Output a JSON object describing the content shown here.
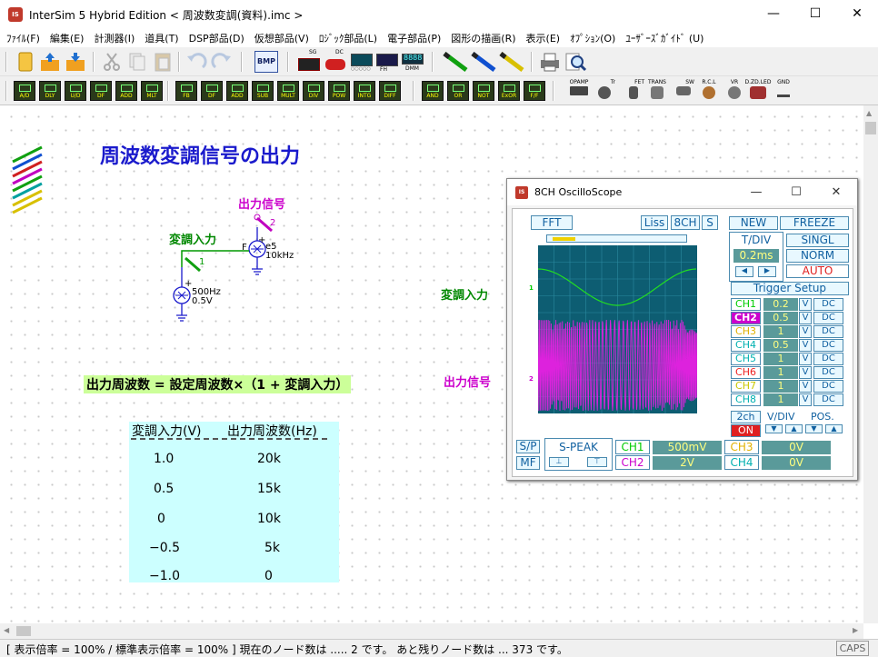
{
  "window": {
    "app_icon_text": "IS",
    "title": "InterSim 5  Hybrid Edition  < 周波数変調(資料).imc >",
    "minimize": "—",
    "maximize": "☐",
    "close": "✕"
  },
  "menu": [
    "ﾌｧｲﾙ(F)",
    "編集(E)",
    "計測器(I)",
    "道具(T)",
    "DSP部品(D)",
    "仮想部品(V)",
    "ﾛｼﾞｯｸ部品(L)",
    "電子部品(P)",
    "図形の描画(R)",
    "表示(E)",
    "ｵﾌﾟｼｮﾝ(O)",
    "ﾕｰｻﾞｰｽﾞｶﾞｲﾄﾞ (U)"
  ],
  "toolbar1": {
    "icons": [
      "new-file-icon",
      "open-file-icon",
      "save-file-icon",
      "cut-icon",
      "copy-icon",
      "paste-icon",
      "undo-icon",
      "redo-icon",
      "bmp-export-icon",
      "signal-generator-icon",
      "dc-source-icon",
      "oscilloscope-icon",
      "spectrum-icon",
      "digital-meter-icon",
      "probe-green-icon",
      "probe-blue-icon",
      "probe-yellow-icon",
      "print-icon",
      "print-preview-icon"
    ],
    "labels": {
      "bmp": "BMP",
      "sg": "SG",
      "dc": "DC",
      "fh": "FH",
      "dmm": "DMM",
      "digits": "8888"
    }
  },
  "toolbar2": {
    "dsp_buttons": [
      "A/D",
      "DLY",
      "U/D",
      "DF",
      "ADD",
      "MLT",
      "FB",
      "DF",
      "ADD",
      "SUB",
      "MULT",
      "DIV",
      "POW",
      "INTG",
      "DIFF"
    ],
    "logic_buttons": [
      "AND",
      "OR",
      "NOT",
      "ExOR",
      "F/F"
    ],
    "components": [
      "OPAMP",
      "Tr",
      "FET",
      "TRANS",
      "SW",
      "R.C.L",
      "VR",
      "D.ZD.LED",
      "GND"
    ]
  },
  "schematic": {
    "title": "周波数変調信号の出力",
    "output_label": "出力信号",
    "mod_label": "変調入力",
    "vco_fc": "10kHz",
    "vco_name": "e5",
    "src_freq": "500Hz",
    "src_amp": "0.5V",
    "node1": "1",
    "node2": "2",
    "pin_f": "F",
    "plus": "+",
    "formula": "出力周波数 = 設定周波数×（1 + 変調入力）",
    "table": {
      "headers": [
        "変調入力(V)",
        "出力周波数(Hz)"
      ],
      "rows": [
        [
          "1.0",
          "20k"
        ],
        [
          "0.5",
          "15k"
        ],
        [
          "0",
          "10k"
        ],
        [
          "−0.5",
          "5k"
        ],
        [
          "−1.0",
          "0"
        ]
      ]
    },
    "scope_label_mod": "変調入力",
    "scope_label_out": "出力信号"
  },
  "oscilloscope": {
    "icon_text": "IS",
    "title": "8CH OscilloScope",
    "minimize": "—",
    "maximize": "☐",
    "close": "✕",
    "fft": "FFT",
    "liss": "Liss",
    "eight_ch": "8CH",
    "s": "S",
    "new": "NEW",
    "freeze": "FREEZE",
    "tdiv_label": "T/DIV",
    "tdiv_value": "0.2ms",
    "singl": "SINGL",
    "norm": "NORM",
    "auto": "AUTO",
    "trigger_setup": "Trigger Setup",
    "channels": [
      {
        "name": "CH1",
        "value": "0.2",
        "unit": "V",
        "coupling": "DC",
        "color": "#00cc00",
        "active": false
      },
      {
        "name": "CH2",
        "value": "0.5",
        "unit": "V",
        "coupling": "DC",
        "color": "#cc00cc",
        "active": true
      },
      {
        "name": "CH3",
        "value": "1",
        "unit": "V",
        "coupling": "DC",
        "color": "#e0b000",
        "active": false
      },
      {
        "name": "CH4",
        "value": "0.5",
        "unit": "V",
        "coupling": "DC",
        "color": "#00b0b0",
        "active": false
      },
      {
        "name": "CH5",
        "value": "1",
        "unit": "V",
        "coupling": "DC",
        "color": "#00b0b0",
        "active": false
      },
      {
        "name": "CH6",
        "value": "1",
        "unit": "V",
        "coupling": "DC",
        "color": "#ee2222",
        "active": false
      },
      {
        "name": "CH7",
        "value": "1",
        "unit": "V",
        "coupling": "DC",
        "color": "#c8c800",
        "active": false
      },
      {
        "name": "CH8",
        "value": "1",
        "unit": "V",
        "coupling": "DC",
        "color": "#00b0b0",
        "active": false
      }
    ],
    "two_ch": "2ch",
    "on": "ON",
    "vdiv": "V/DIV",
    "pos": "POS.",
    "sp": "S/P",
    "mf": "MF",
    "speak": "S-PEAK",
    "readouts": [
      {
        "ch": "CH1",
        "value": "500mV",
        "color": "#00cc00"
      },
      {
        "ch": "CH2",
        "value": "2V",
        "color": "#cc00cc"
      },
      {
        "ch": "CH3",
        "value": "0V",
        "color": "#e0b000"
      },
      {
        "ch": "CH4",
        "value": "0V",
        "color": "#00b0b0"
      }
    ],
    "marker_ch1": "1",
    "marker_ch2": "2"
  },
  "status": {
    "text": "[ 表示倍率 = 100% / 標準表示倍率 = 100% ] 現在のノード数は ..... 2 です。 あと残りノード数は ... 373 です。",
    "caps": "CAPS"
  }
}
